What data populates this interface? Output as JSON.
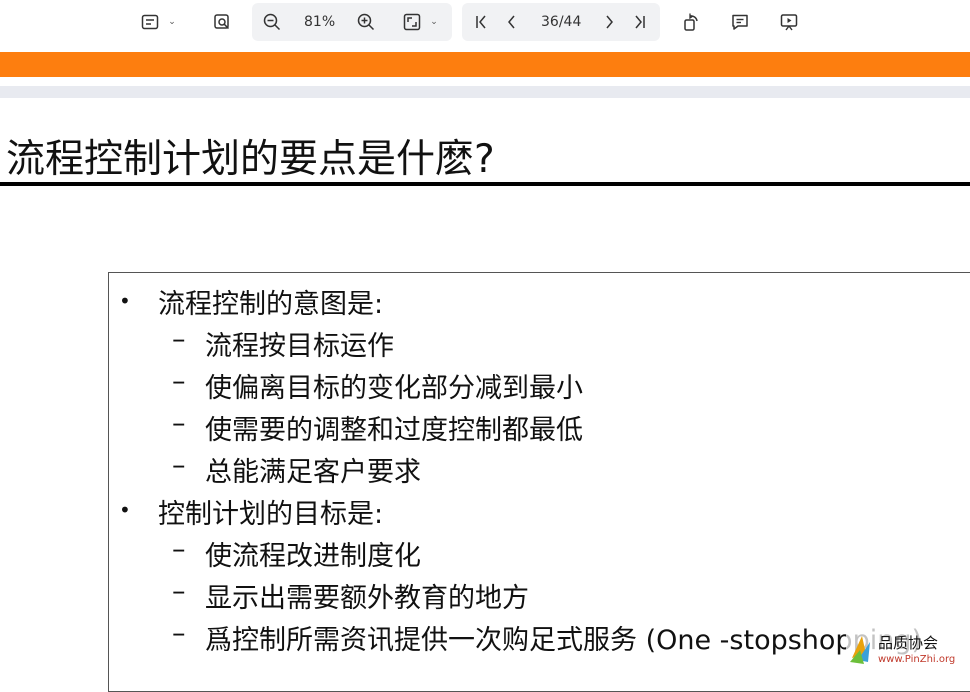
{
  "toolbar": {
    "zoom": "81%",
    "page_current": "36",
    "page_total": "44",
    "page_indicator": "36/44"
  },
  "slide": {
    "title": "流程控制计划的要点是什麽?",
    "sections": [
      {
        "heading": "流程控制的意图是:",
        "items": [
          "流程按目标运作",
          "使偏离目标的变化部分减到最小",
          "使需要的调整和过度控制都最低",
          "总能满足客户要求"
        ]
      },
      {
        "heading": "控制计划的目标是:",
        "items": [
          "使流程改进制度化",
          "显示出需要额外教育的地方",
          "爲控制所需资讯提供一次购足式服务 (One -stopshopping)"
        ]
      }
    ],
    "dash": "–",
    "bullet": "•"
  },
  "watermark": {
    "cn": "品质协会",
    "url": "www.PinZhi.org"
  },
  "colors": {
    "orange_bar": "#fd7e0f",
    "toolbar_group_bg": "#f1f2f4",
    "title_rule": "#000000"
  },
  "icons": [
    "page-view-icon",
    "search-page-icon",
    "zoom-out-icon",
    "zoom-in-icon",
    "fit-page-icon",
    "first-page-icon",
    "previous-page-icon",
    "next-page-icon",
    "last-page-icon",
    "rotate-icon",
    "comment-icon",
    "presentation-icon"
  ]
}
